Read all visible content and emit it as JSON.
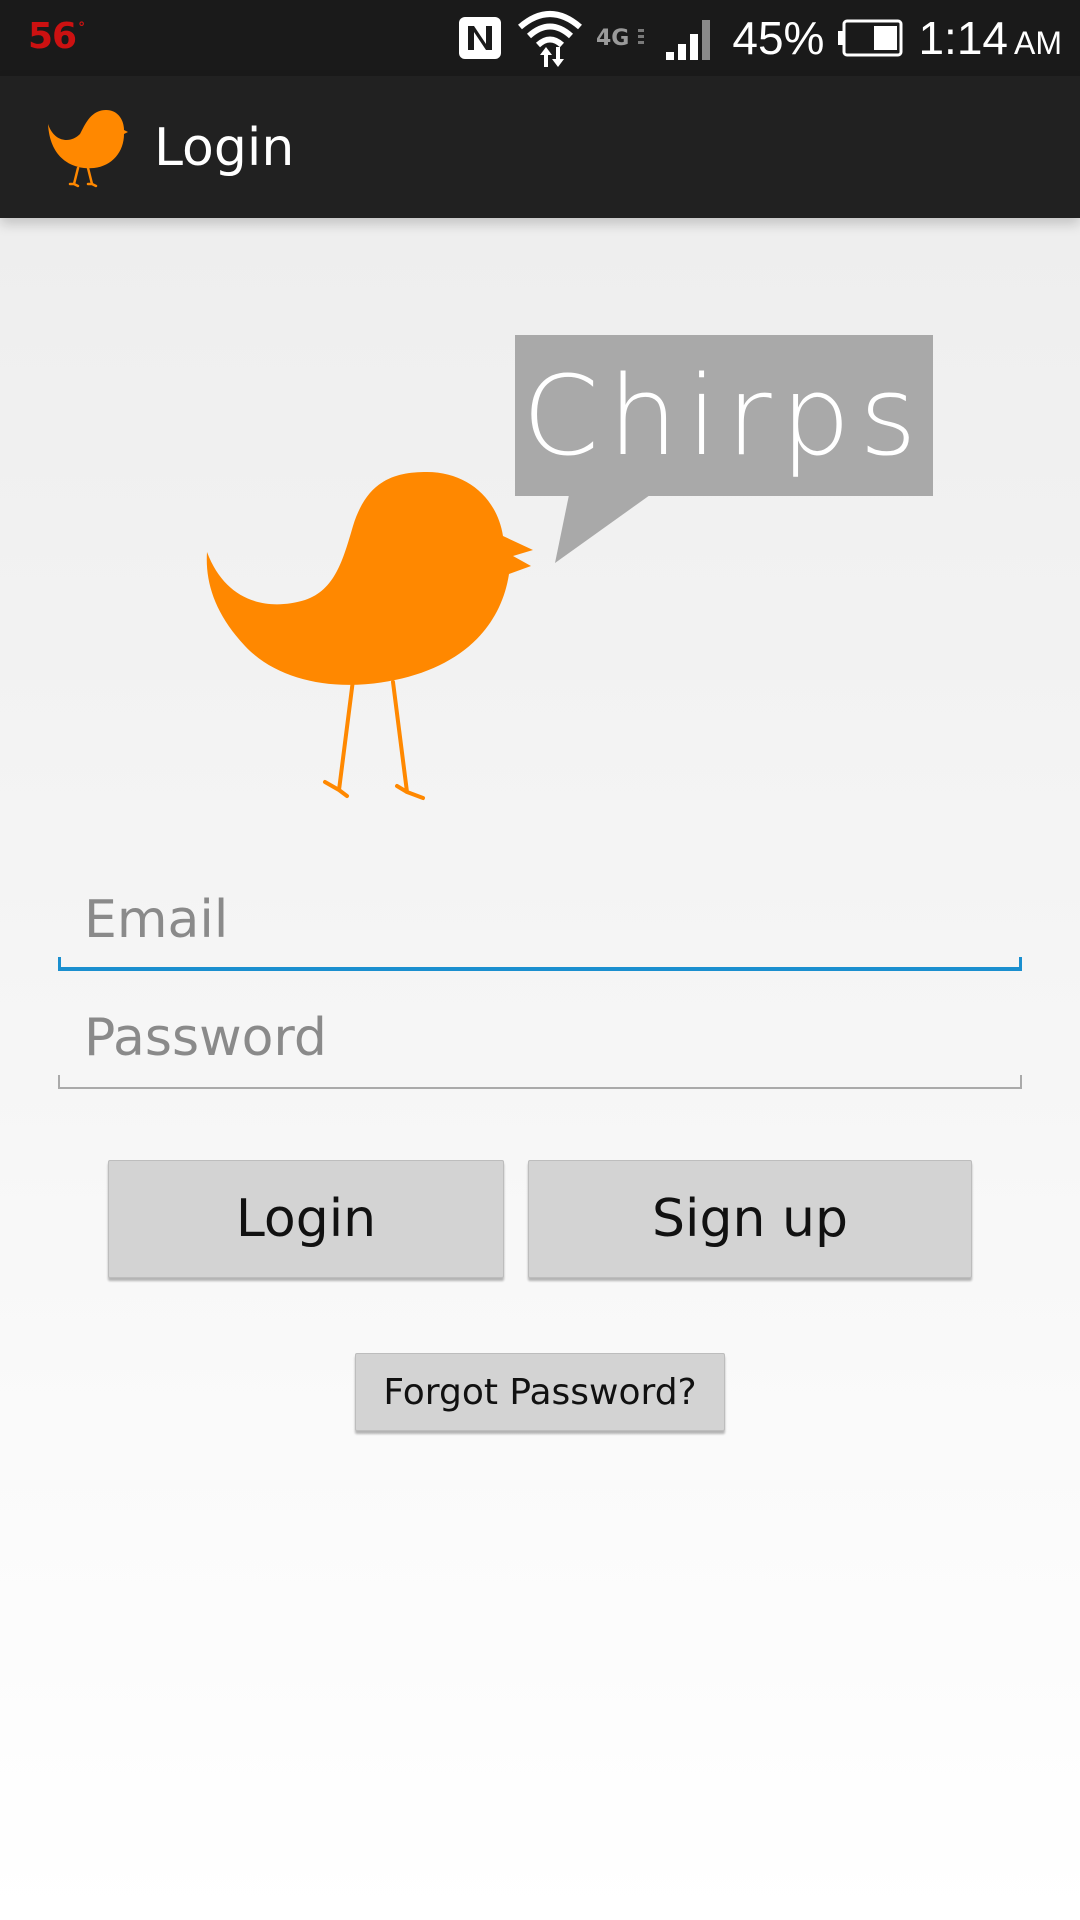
{
  "status_bar": {
    "temperature": "56",
    "temperature_unit": "°",
    "network_type": "4G",
    "battery_percent": "45%",
    "battery_level": 0.45,
    "time": "1:14",
    "ampm": "AM",
    "icons": [
      "nfc-icon",
      "wifi-icon",
      "4g-icon",
      "signal-icon",
      "battery-icon"
    ]
  },
  "action_bar": {
    "title": "Login",
    "app_icon": "bird-icon"
  },
  "logo": {
    "speech_text": "Chirps",
    "bird_color": "#ff8800",
    "speech_color": "#a9a9a9"
  },
  "form": {
    "email": {
      "placeholder": "Email",
      "value": ""
    },
    "password": {
      "placeholder": "Password",
      "value": ""
    }
  },
  "buttons": {
    "login": "Login",
    "signup": "Sign up",
    "forgot": "Forgot Password?"
  },
  "colors": {
    "accent": "#1a8fcf",
    "action_bar_bg": "#212121",
    "status_bar_bg": "#1a1a1a",
    "temp_color": "#cc1111"
  }
}
